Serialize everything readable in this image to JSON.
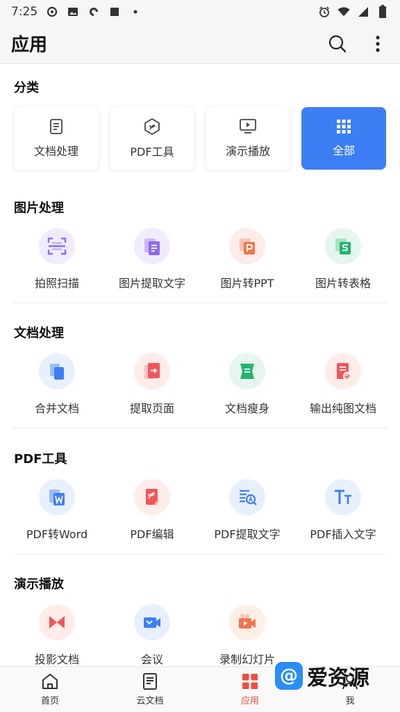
{
  "status": {
    "time": "7:25"
  },
  "app_bar": {
    "title": "应用"
  },
  "category": {
    "title": "分类",
    "items": [
      {
        "label": "文档处理",
        "icon": "document-icon"
      },
      {
        "label": "PDF工具",
        "icon": "pdf-hex-icon"
      },
      {
        "label": "演示播放",
        "icon": "presentation-icon"
      },
      {
        "label": "全部",
        "icon": "grid-icon"
      }
    ]
  },
  "image_processing": {
    "title": "图片处理",
    "items": [
      {
        "label": "拍照扫描",
        "icon": "scan-icon"
      },
      {
        "label": "图片提取文字",
        "icon": "image-text-icon"
      },
      {
        "label": "图片转PPT",
        "icon": "image-ppt-icon"
      },
      {
        "label": "图片转表格",
        "icon": "image-sheet-icon"
      }
    ]
  },
  "doc_processing": {
    "title": "文档处理",
    "items": [
      {
        "label": "合并文档",
        "icon": "merge-icon"
      },
      {
        "label": "提取页面",
        "icon": "extract-page-icon"
      },
      {
        "label": "文档瘦身",
        "icon": "slim-icon"
      },
      {
        "label": "输出纯图文档",
        "icon": "image-doc-icon"
      }
    ]
  },
  "pdf_tools": {
    "title": "PDF工具",
    "items": [
      {
        "label": "PDF转Word",
        "icon": "pdf-word-icon"
      },
      {
        "label": "PDF编辑",
        "icon": "pdf-edit-icon"
      },
      {
        "label": "PDF提取文字",
        "icon": "pdf-text-icon"
      },
      {
        "label": "PDF插入文字",
        "icon": "insert-text-icon"
      }
    ]
  },
  "presentation": {
    "title": "演示播放",
    "items": [
      {
        "label": "投影文档",
        "icon": "projection-icon"
      },
      {
        "label": "会议",
        "icon": "meeting-icon"
      },
      {
        "label": "录制幻灯片",
        "icon": "record-icon"
      }
    ]
  },
  "bottom_nav": {
    "items": [
      {
        "label": "首页",
        "icon": "home-icon"
      },
      {
        "label": "云文档",
        "icon": "cloud-doc-icon"
      },
      {
        "label": "应用",
        "icon": "apps-icon"
      },
      {
        "label": "我",
        "icon": "profile-icon"
      }
    ]
  },
  "watermark": {
    "text": "爱资源"
  },
  "colors": {
    "accent": "#3d7ef5",
    "active_nav": "#f04e3e"
  }
}
